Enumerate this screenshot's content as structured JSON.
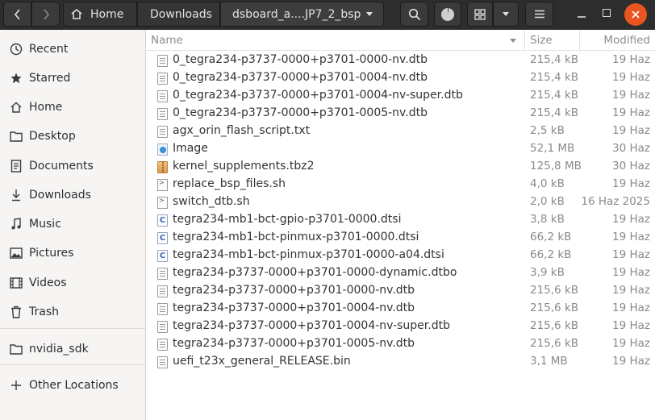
{
  "headerbar": {
    "back_icon": "chevron-left-icon",
    "forward_icon": "chevron-right-icon",
    "breadcrumbs": [
      {
        "label": "Home",
        "icon": "home-icon"
      },
      {
        "label": "Downloads"
      },
      {
        "label": "dsboard_a....JP7_2_bsp",
        "icon": "chevron-down-icon"
      }
    ],
    "accent_close": "#e95420"
  },
  "sidebar": {
    "items": [
      {
        "label": "Recent",
        "icon": "clock-icon"
      },
      {
        "label": "Starred",
        "icon": "star-icon"
      },
      {
        "label": "Home",
        "icon": "home-icon"
      },
      {
        "label": "Desktop",
        "icon": "folder-icon"
      },
      {
        "label": "Documents",
        "icon": "document-icon"
      },
      {
        "label": "Downloads",
        "icon": "download-icon"
      },
      {
        "label": "Music",
        "icon": "music-icon"
      },
      {
        "label": "Pictures",
        "icon": "picture-icon"
      },
      {
        "label": "Videos",
        "icon": "video-icon"
      },
      {
        "label": "Trash",
        "icon": "trash-icon"
      }
    ],
    "bookmarks": [
      {
        "label": "nvidia_sdk",
        "icon": "folder-icon"
      }
    ],
    "other": {
      "label": "Other Locations",
      "icon": "plus-icon"
    }
  },
  "columns": {
    "name": "Name",
    "size": "Size",
    "modified": "Modified"
  },
  "files": [
    {
      "name": "0_tegra234-p3737-0000+p3701-0000-nv.dtb",
      "size": "215,4 kB",
      "modified": "19 Haz",
      "type": "doc"
    },
    {
      "name": "0_tegra234-p3737-0000+p3701-0004-nv.dtb",
      "size": "215,4 kB",
      "modified": "19 Haz",
      "type": "doc"
    },
    {
      "name": "0_tegra234-p3737-0000+p3701-0004-nv-super.dtb",
      "size": "215,4 kB",
      "modified": "19 Haz",
      "type": "doc"
    },
    {
      "name": "0_tegra234-p3737-0000+p3701-0005-nv.dtb",
      "size": "215,4 kB",
      "modified": "19 Haz",
      "type": "doc"
    },
    {
      "name": "agx_orin_flash_script.txt",
      "size": "2,5 kB",
      "modified": "19 Haz",
      "type": "doc"
    },
    {
      "name": "Image",
      "size": "52,1 MB",
      "modified": "30 Haz",
      "type": "image"
    },
    {
      "name": "kernel_supplements.tbz2",
      "size": "125,8 MB",
      "modified": "30 Haz",
      "type": "archive"
    },
    {
      "name": "replace_bsp_files.sh",
      "size": "4,0 kB",
      "modified": "19 Haz",
      "type": "script"
    },
    {
      "name": "switch_dtb.sh",
      "size": "2,0 kB",
      "modified": "16 Haz 2025",
      "type": "script"
    },
    {
      "name": "tegra234-mb1-bct-gpio-p3701-0000.dtsi",
      "size": "3,8 kB",
      "modified": "19 Haz",
      "type": "c"
    },
    {
      "name": "tegra234-mb1-bct-pinmux-p3701-0000.dtsi",
      "size": "66,2 kB",
      "modified": "19 Haz",
      "type": "c"
    },
    {
      "name": "tegra234-mb1-bct-pinmux-p3701-0000-a04.dtsi",
      "size": "66,2 kB",
      "modified": "19 Haz",
      "type": "c"
    },
    {
      "name": "tegra234-p3737-0000+p3701-0000-dynamic.dtbo",
      "size": "3,9 kB",
      "modified": "19 Haz",
      "type": "doc"
    },
    {
      "name": "tegra234-p3737-0000+p3701-0000-nv.dtb",
      "size": "215,6 kB",
      "modified": "19 Haz",
      "type": "doc"
    },
    {
      "name": "tegra234-p3737-0000+p3701-0004-nv.dtb",
      "size": "215,6 kB",
      "modified": "19 Haz",
      "type": "doc"
    },
    {
      "name": "tegra234-p3737-0000+p3701-0004-nv-super.dtb",
      "size": "215,6 kB",
      "modified": "19 Haz",
      "type": "doc"
    },
    {
      "name": "tegra234-p3737-0000+p3701-0005-nv.dtb",
      "size": "215,6 kB",
      "modified": "19 Haz",
      "type": "doc"
    },
    {
      "name": "uefi_t23x_general_RELEASE.bin",
      "size": "3,1 MB",
      "modified": "19 Haz",
      "type": "doc"
    }
  ]
}
